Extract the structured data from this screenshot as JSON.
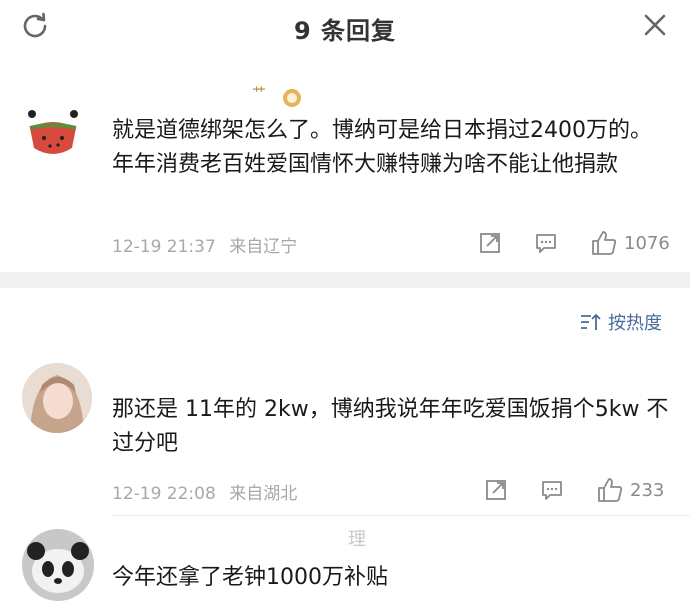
{
  "header": {
    "title": "9 条回复",
    "refresh_icon": "refresh-icon",
    "close_icon": "close-icon"
  },
  "main_comment": {
    "text": "就是道德绑架怎么了。博纳可是给日本捐过2400万的。年年消费老百姓爱国情怀大赚特赚为啥不能让他捐款",
    "time": "12-19 21:37",
    "location": "来自辽宁",
    "likes": "1076"
  },
  "sort": {
    "label": "按热度"
  },
  "replies": [
    {
      "text": "那还是 11年的 2kw，博纳我说年年吃爱国饭捐个5kw 不过分吧",
      "time": "12-19 22:08",
      "location": "来自湖北",
      "likes": "233"
    },
    {
      "partial_top": "理",
      "text": "今年还拿了老钟1000万补贴"
    }
  ],
  "colors": {
    "accent": "#4a6c9b",
    "meta": "#a8a8a8",
    "band": "#f1f1f1"
  }
}
